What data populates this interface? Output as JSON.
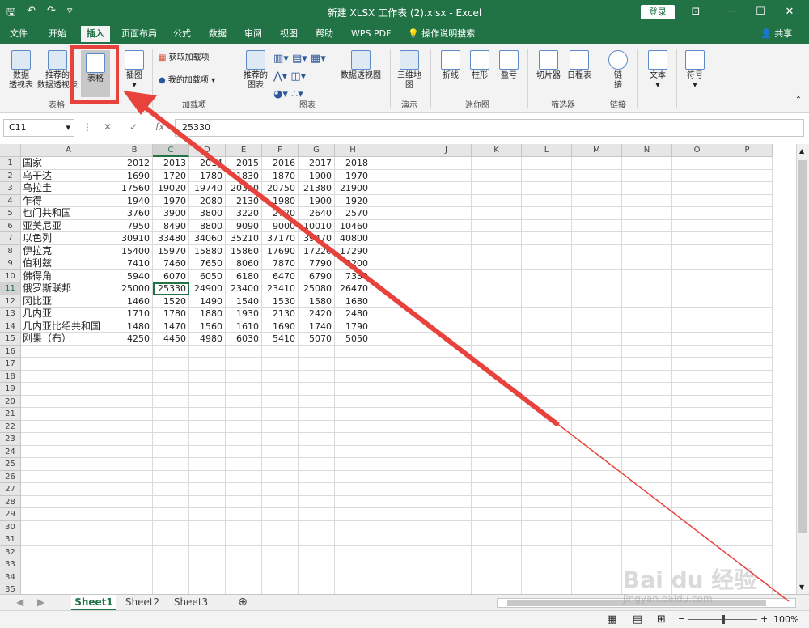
{
  "window": {
    "title": "新建 XLSX 工作表 (2).xlsx  -  Excel",
    "login": "登录"
  },
  "qat": {
    "save": "🖫",
    "undo": "↶",
    "redo": "↷",
    "more": "▿"
  },
  "tabs": [
    {
      "label": "文件"
    },
    {
      "label": "开始"
    },
    {
      "label": "插入"
    },
    {
      "label": "页面布局"
    },
    {
      "label": "公式"
    },
    {
      "label": "数据"
    },
    {
      "label": "审阅"
    },
    {
      "label": "视图"
    },
    {
      "label": "帮助"
    },
    {
      "label": "WPS PDF"
    },
    {
      "label": "操作说明搜索"
    }
  ],
  "share": "共享",
  "ribbon": {
    "pivot": "数据\n透视表",
    "rec_pivot": "推荐的\n数据透视表",
    "table": "表格",
    "illus": "插图",
    "get_addins": "获取加载项",
    "my_addins": "我的加载项",
    "rec_charts": "推荐的\n图表",
    "pivot_chart": "数据透视图",
    "map3d": "三维地\n图",
    "line": "折线",
    "column": "柱形",
    "winloss": "盈亏",
    "slicer": "切片器",
    "timeline": "日程表",
    "link": "链\n接",
    "text": "文本",
    "symbol": "符号",
    "groups": {
      "tables": "表格",
      "addins": "加载项",
      "charts": "图表",
      "tours": "演示",
      "sparklines": "迷你图",
      "filters": "筛选器",
      "links": "链接"
    }
  },
  "formula": {
    "namebox": "C11",
    "value": "25330",
    "fx": "fx"
  },
  "columns": [
    "A",
    "B",
    "C",
    "D",
    "E",
    "F",
    "G",
    "H",
    "I",
    "J",
    "K",
    "L",
    "M",
    "N",
    "O",
    "P"
  ],
  "rows": [
    [
      "国家",
      "2012",
      "2013",
      "2014",
      "2015",
      "2016",
      "2017",
      "2018"
    ],
    [
      "乌干达",
      "1690",
      "1720",
      "1780",
      "1830",
      "1870",
      "1900",
      "1970"
    ],
    [
      "乌拉圭",
      "17560",
      "19020",
      "19740",
      "20350",
      "20750",
      "21380",
      "21900"
    ],
    [
      "乍得",
      "1940",
      "1970",
      "2080",
      "2130",
      "1980",
      "1900",
      "1920"
    ],
    [
      "也门共和国",
      "3760",
      "3900",
      "3800",
      "3220",
      "2720",
      "2640",
      "2570"
    ],
    [
      "亚美尼亚",
      "7950",
      "8490",
      "8800",
      "9090",
      "9000",
      "10010",
      "10460"
    ],
    [
      "以色列",
      "30910",
      "33480",
      "34060",
      "35210",
      "37170",
      "39470",
      "40800"
    ],
    [
      "伊拉克",
      "15400",
      "15970",
      "15880",
      "15860",
      "17690",
      "17220",
      "17290"
    ],
    [
      "伯利兹",
      "7410",
      "7460",
      "7650",
      "8060",
      "7870",
      "7790",
      "8200"
    ],
    [
      "佛得角",
      "5940",
      "6070",
      "6050",
      "6180",
      "6470",
      "6790",
      "7330"
    ],
    [
      "俄罗斯联邦",
      "25000",
      "25330",
      "24900",
      "23400",
      "23410",
      "25080",
      "26470"
    ],
    [
      "冈比亚",
      "1460",
      "1520",
      "1490",
      "1540",
      "1530",
      "1580",
      "1680"
    ],
    [
      "几内亚",
      "1710",
      "1780",
      "1880",
      "1930",
      "2130",
      "2420",
      "2480"
    ],
    [
      "几内亚比绍共和国",
      "1480",
      "1470",
      "1560",
      "1610",
      "1690",
      "1740",
      "1790"
    ],
    [
      "刚果（布）",
      "4250",
      "4450",
      "4980",
      "6030",
      "5410",
      "5070",
      "5050"
    ]
  ],
  "total_rows": 35,
  "sheets": [
    "Sheet1",
    "Sheet2",
    "Sheet3"
  ],
  "zoom": "100%",
  "watermark": "Bai du 经验",
  "watermark_url": "jingyan.baidu.com"
}
